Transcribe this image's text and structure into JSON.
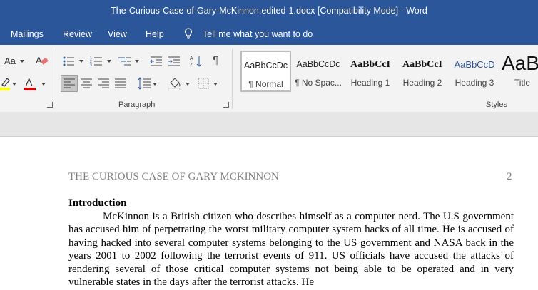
{
  "window": {
    "title": "The-Curious-Case-of-Gary-McKinnon.edited-1.docx [Compatibility Mode]  -  Word"
  },
  "menu": {
    "tabs": [
      "Mailings",
      "Review",
      "View",
      "Help"
    ],
    "tell_me": "Tell me what you want to do"
  },
  "ribbon": {
    "font_group_partial": {
      "change_case": "Aa"
    },
    "paragraph_group_label": "Paragraph",
    "styles_group_label": "Styles",
    "styles": [
      {
        "sample": "AaBbCcDc",
        "name": "¶ Normal",
        "selected": true
      },
      {
        "sample": "AaBbCcDc",
        "name": "¶ No Spac..."
      },
      {
        "sample": "AaBbCcI",
        "name": "Heading 1"
      },
      {
        "sample": "AaBbCcI",
        "name": "Heading 2"
      },
      {
        "sample": "AaBbCcD",
        "name": "Heading 3"
      },
      {
        "sample": "AaB",
        "name": "Title"
      }
    ],
    "colors": {
      "highlight": "#ffff00",
      "font_color": "#e00000",
      "accent": "#2b579a"
    }
  },
  "document": {
    "header": "THE CURIOUS CASE OF GARY MCKINNON",
    "page_number": "2",
    "heading": "Introduction",
    "paragraph": "McKinnon is a British citizen who describes himself as a computer nerd. The U.S government has accused him of perpetrating the worst military computer system hacks of all time. He is accused of having hacked into several computer systems belonging to the US government and NASA back in the years 2001 to 2002 following the terrorist events of 911. US officials have accused the attacks of rendering several of those critical computer systems not being able to be operated and in very vulnerable states in the days after the terrorist attacks. He"
  }
}
